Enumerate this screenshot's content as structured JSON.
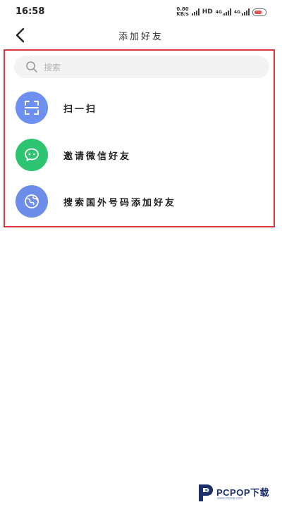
{
  "status_bar": {
    "time": "16:58",
    "speed_value": "0.80",
    "speed_unit": "KB/s",
    "hd_label": "HD",
    "net1": "4G",
    "net2": "4G"
  },
  "header": {
    "title": "添加好友",
    "back_icon": "chevron-left-icon"
  },
  "search": {
    "placeholder": "搜索",
    "value": "",
    "icon": "search-icon"
  },
  "actions": [
    {
      "label": "扫一扫",
      "icon": "scan-icon",
      "color": "#6c8ff0"
    },
    {
      "label": "邀请微信好友",
      "icon": "wechat-icon",
      "color": "#2ec472"
    },
    {
      "label": "搜索国外号码添加好友",
      "icon": "globe-icon",
      "color": "#6d8de8"
    }
  ],
  "highlight_color": "#d9363e",
  "watermark": {
    "brand": "PCPOP下载",
    "sub": "www.pcpop.com"
  }
}
